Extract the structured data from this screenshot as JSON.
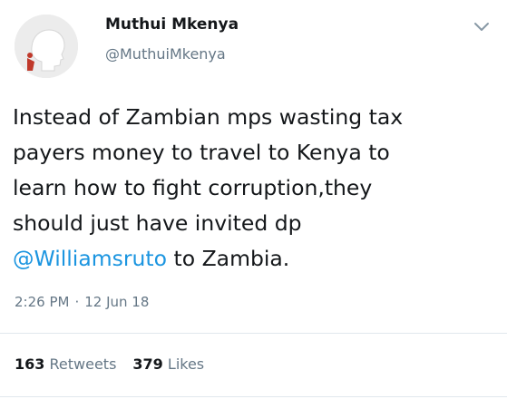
{
  "user": {
    "display_name": "Muthui Mkenya",
    "handle": "@MuthuiMkenya",
    "avatar_icon": "default-profile-head-icon"
  },
  "menu_icon": "chevron-down-icon",
  "tweet": {
    "lines": [
      "Instead of Zambian mps wasting tax",
      "payers money to travel to Kenya to",
      "learn how to fight corruption,they",
      "should just have invited dp"
    ],
    "mention": "@Williamsruto",
    "tail": " to Zambia."
  },
  "meta": {
    "time": "2:26 PM",
    "separator": "·",
    "date": "12 Jun 18"
  },
  "stats": {
    "retweets_count": "163",
    "retweets_label": "Retweets",
    "likes_count": "379",
    "likes_label": "Likes"
  },
  "colors": {
    "link": "#1b95e0",
    "secondary_text": "#657786",
    "divider": "#e1e8ed"
  }
}
